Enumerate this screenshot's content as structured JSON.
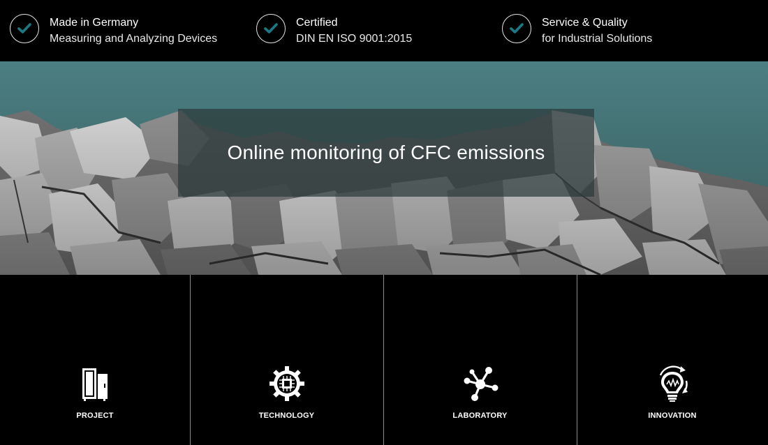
{
  "colors": {
    "accent": "#1c7a85",
    "hero_sky": "#4e8285",
    "banner_bg": "#2d3a3a"
  },
  "features": [
    {
      "icon": "check-circle-icon",
      "title": "Made in Germany",
      "subtitle": "Measuring and Analyzing Devices"
    },
    {
      "icon": "check-circle-icon",
      "title": "Certified",
      "subtitle": "DIN EN ISO 9001:2015"
    },
    {
      "icon": "check-circle-icon",
      "title": "Service & Quality",
      "subtitle": "for Industrial Solutions"
    }
  ],
  "hero": {
    "headline": "Online monitoring of CFC emissions"
  },
  "tiles": [
    {
      "icon": "refrigerator-icon",
      "label": "PROJECT"
    },
    {
      "icon": "gear-chip-icon",
      "label": "TECHNOLOGY"
    },
    {
      "icon": "molecule-icon",
      "label": "LABORATORY"
    },
    {
      "icon": "lightbulb-icon",
      "label": "INNOVATION"
    }
  ]
}
